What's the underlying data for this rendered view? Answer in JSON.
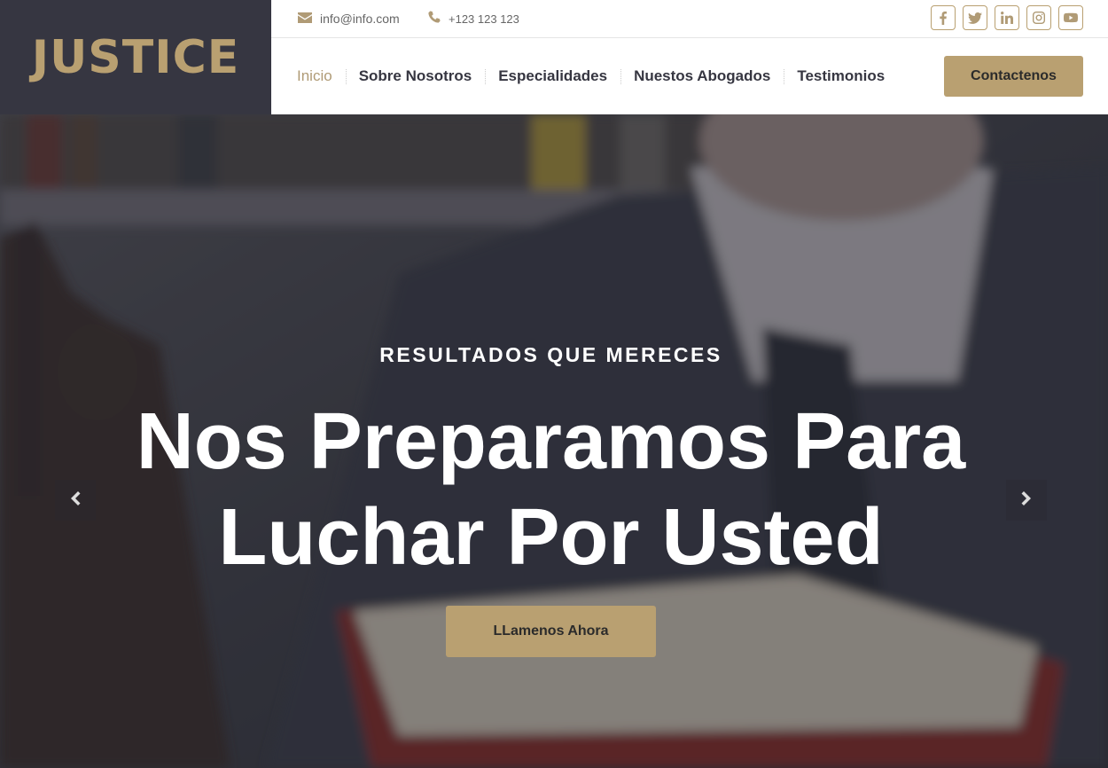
{
  "brand": {
    "logo_text": "JUSTICE"
  },
  "topbar": {
    "email": "info@info.com",
    "phone": "+123 123 123",
    "socials": [
      "facebook-icon",
      "twitter-icon",
      "linkedin-icon",
      "instagram-icon",
      "youtube-icon"
    ]
  },
  "nav": {
    "items": [
      {
        "label": "Inicio",
        "active": true
      },
      {
        "label": "Sobre Nosotros",
        "active": false
      },
      {
        "label": "Especialidades",
        "active": false
      },
      {
        "label": "Nuestos Abogados",
        "active": false
      },
      {
        "label": "Testimonios",
        "active": false
      }
    ],
    "cta_label": "Contactenos"
  },
  "hero": {
    "subtitle": "RESULTADOS QUE MERECES",
    "title_line1": "Nos Preparamos Para",
    "title_line2": "Luchar Por Usted",
    "button_label": "LLamenos Ahora"
  },
  "colors": {
    "accent": "#b9a071",
    "dark": "#363641"
  }
}
